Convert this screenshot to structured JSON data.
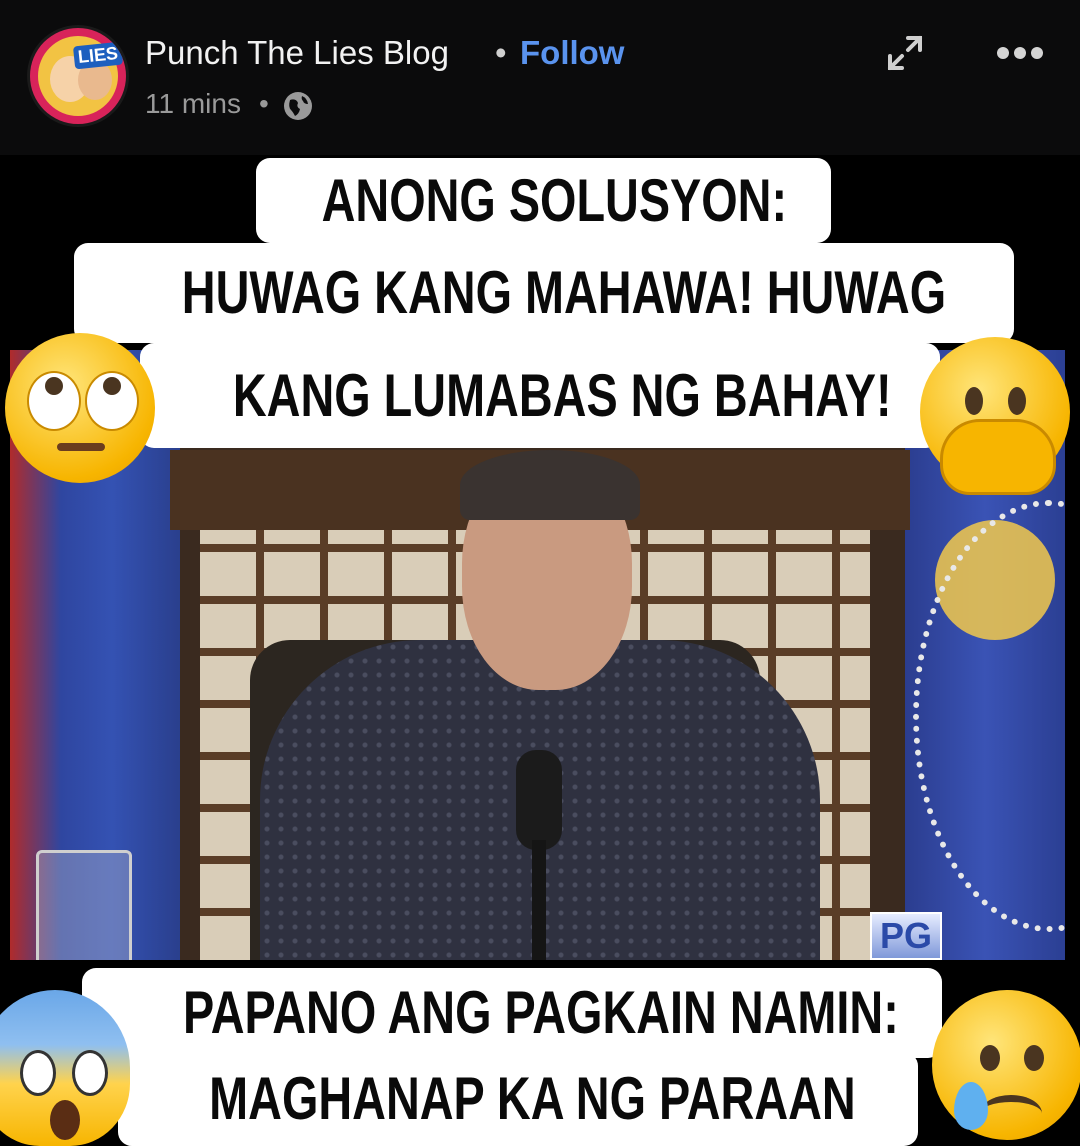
{
  "header": {
    "page_name": "Punch The Lies Blog",
    "separator": "•",
    "follow_label": "Follow",
    "time": "11 mins",
    "time_separator": "•",
    "avatar_logo_text": "LIES",
    "icons": [
      "globe-icon",
      "expand-icon",
      "more-options-icon"
    ]
  },
  "captions": {
    "top_line1": "ANONG SOLUSYON:",
    "top_line2": "HUWAG KANG MAHAWA! HUWAG",
    "top_line3": "KANG LUMABAS NG BAHAY!",
    "bottom_line1": "PAPANO ANG PAGKAIN NAMIN:",
    "bottom_line2": "MAGHANAP KA NG PARAAN"
  },
  "video": {
    "rating_badge": "PG"
  },
  "emojis": [
    "face-with-rolling-eyes",
    "face-with-hand-over-mouth",
    "face-screaming-in-fear",
    "crying-face"
  ],
  "colors": {
    "header_bg": "#0b0b0c",
    "follow": "#5a93ee",
    "caption_bg": "#ffffff"
  }
}
